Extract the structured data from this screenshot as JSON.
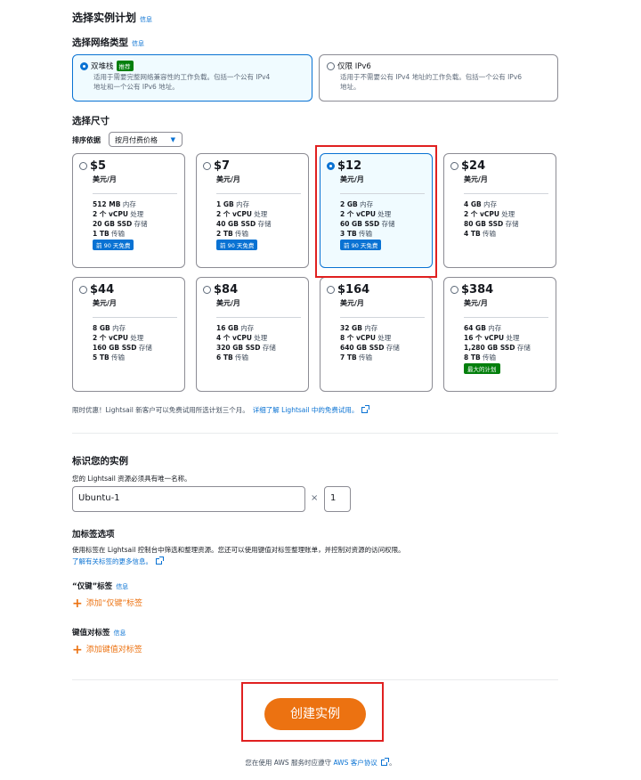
{
  "plan": {
    "title": "选择实例计划",
    "info": "信息"
  },
  "network": {
    "title": "选择网络类型",
    "info": "信息",
    "options": [
      {
        "label": "双堆栈",
        "badge": "推荐",
        "desc_line1": "适用于需要完整网络兼容性的工作负载。包括一个公有 IPv4",
        "desc_line2": "地址和一个公有 IPv6 地址。",
        "selected": true
      },
      {
        "label": "仅限 IPv6",
        "desc_line1": "适用于不需要公有 IPv4 地址的工作负载。包括一个公有 IPv6",
        "desc_line2": "地址。",
        "selected": false
      }
    ]
  },
  "size": {
    "title": "选择尺寸",
    "sort_label": "排序依据",
    "sort_value": "按月付费价格",
    "unit": "美元/月",
    "plans": [
      {
        "price": "$5",
        "mem": "512 MB",
        "mem_l": " 内存",
        "cpu": "2 个 vCPU",
        "cpu_l": " 处理",
        "ssd": "20 GB SSD",
        "ssd_l": " 存储",
        "xfer": "1 TB",
        "xfer_l": " 传输",
        "tag": "前 90 天免费",
        "selected": false
      },
      {
        "price": "$7",
        "mem": "1 GB",
        "mem_l": " 内存",
        "cpu": "2 个 vCPU",
        "cpu_l": " 处理",
        "ssd": "40 GB SSD",
        "ssd_l": " 存储",
        "xfer": "2 TB",
        "xfer_l": " 传输",
        "tag": "前 90 天免费",
        "selected": false
      },
      {
        "price": "$12",
        "mem": "2 GB",
        "mem_l": " 内存",
        "cpu": "2 个 vCPU",
        "cpu_l": " 处理",
        "ssd": "60 GB SSD",
        "ssd_l": " 存储",
        "xfer": "3 TB",
        "xfer_l": " 传输",
        "tag": "前 90 天免费",
        "selected": true
      },
      {
        "price": "$24",
        "mem": "4 GB",
        "mem_l": " 内存",
        "cpu": "2 个 vCPU",
        "cpu_l": " 处理",
        "ssd": "80 GB SSD",
        "ssd_l": " 存储",
        "xfer": "4 TB",
        "xfer_l": " 传输",
        "tag": "",
        "selected": false
      },
      {
        "price": "$44",
        "mem": "8 GB",
        "mem_l": " 内存",
        "cpu": "2 个 vCPU",
        "cpu_l": " 处理",
        "ssd": "160 GB SSD",
        "ssd_l": " 存储",
        "xfer": "5 TB",
        "xfer_l": " 传输",
        "tag": "",
        "selected": false
      },
      {
        "price": "$84",
        "mem": "16 GB",
        "mem_l": " 内存",
        "cpu": "4 个 vCPU",
        "cpu_l": " 处理",
        "ssd": "320 GB SSD",
        "ssd_l": " 存储",
        "xfer": "6 TB",
        "xfer_l": " 传输",
        "tag": "",
        "selected": false
      },
      {
        "price": "$164",
        "mem": "32 GB",
        "mem_l": " 内存",
        "cpu": "8 个 vCPU",
        "cpu_l": " 处理",
        "ssd": "640 GB SSD",
        "ssd_l": " 存储",
        "xfer": "7 TB",
        "xfer_l": " 传输",
        "tag": "",
        "selected": false
      },
      {
        "price": "$384",
        "mem": "64 GB",
        "mem_l": " 内存",
        "cpu": "16 个 vCPU",
        "cpu_l": " 处理",
        "ssd": "1,280 GB SSD",
        "ssd_l": " 存储",
        "xfer": "8 TB",
        "xfer_l": " 传输",
        "tag": "最大的计划",
        "selected": false
      }
    ],
    "promo": "限时优惠！Lightsail 新客户可以免费试用所选计划三个月。",
    "promo_link": "详细了解 Lightsail 中的免费试用。"
  },
  "identify": {
    "title": "标识您的实例",
    "hint": "您的 Lightsail 资源必须具有唯一名称。",
    "name_value": "Ubuntu-1",
    "times": "×",
    "count_value": "1"
  },
  "tags": {
    "title": "加标签选项",
    "desc": "使用标签在 Lightsail 控制台中筛选和整理资源。您还可以使用键值对标签整理账单，并控制对资源的访问权限。",
    "learn_more": "了解有关标签的更多信息。",
    "key_only_title": "“仅键”标签",
    "key_only_info": "信息",
    "add_key_only": "添加“仅键”标签",
    "kv_title": "键值对标签",
    "kv_info": "信息",
    "add_kv": "添加键值对标签"
  },
  "create_button": "创建实例",
  "footer": {
    "text": "您在使用 AWS 服务时应遵守",
    "link": "AWS 客户协议",
    "end": "。"
  },
  "colors": {
    "accent": "#0972d3",
    "primary_button": "#ec7211",
    "badge_green": "#037f0c",
    "highlight_red": "#e02020"
  }
}
